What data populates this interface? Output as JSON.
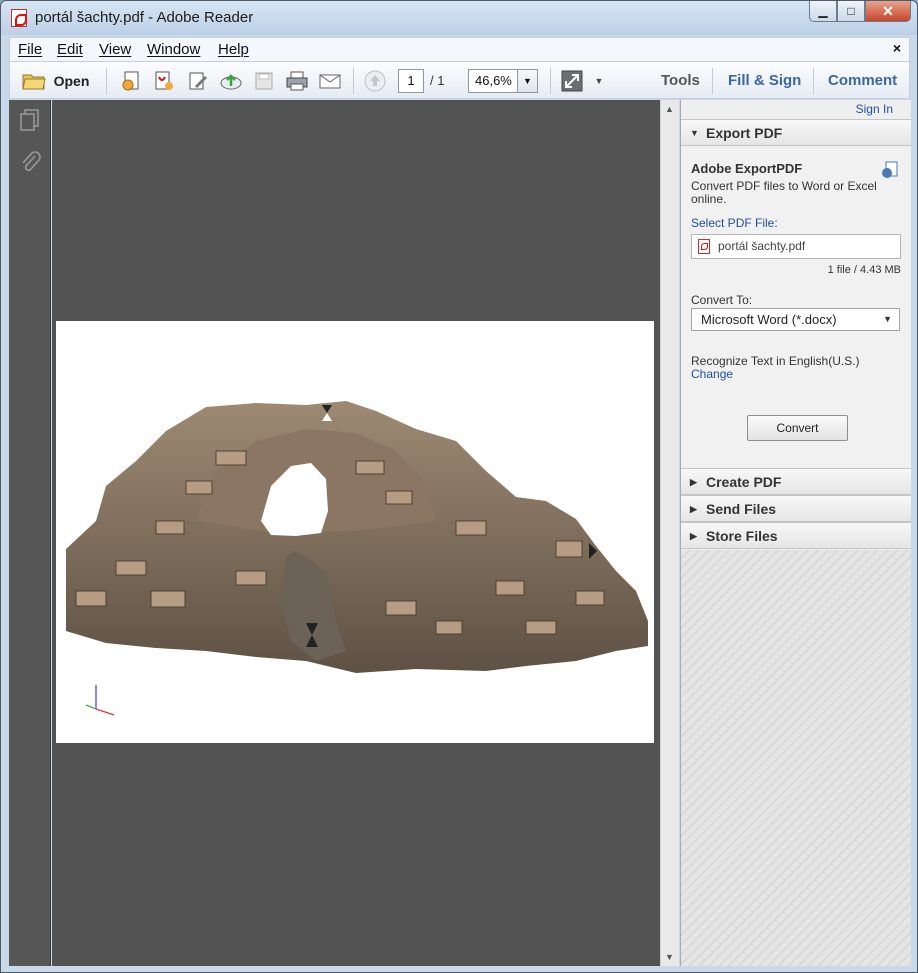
{
  "window": {
    "title": "portál šachty.pdf - Adobe Reader",
    "controls": {
      "minimize": "▁",
      "maximize": "□",
      "close": "✕"
    }
  },
  "menubar": {
    "items": [
      "File",
      "Edit",
      "View",
      "Window",
      "Help"
    ],
    "close": "×"
  },
  "toolbar": {
    "open_label": "Open",
    "page_current": "1",
    "page_total": "/ 1",
    "zoom": "46,6%",
    "tools_label": "Tools",
    "fill_sign_label": "Fill & Sign",
    "comment_label": "Comment"
  },
  "right_panel": {
    "sign_in": "Sign In",
    "export_pdf": {
      "header": "Export PDF",
      "title": "Adobe ExportPDF",
      "description_line1": "Convert PDF files to Word or Excel",
      "description_line2": "online.",
      "select_label": "Select PDF File:",
      "file_name": "portál šachty.pdf",
      "file_info": "1 file / 4.43 MB",
      "convert_to_label": "Convert To:",
      "convert_to_value": "Microsoft Word (*.docx)",
      "recognize_text": "Recognize Text in English(U.S.)",
      "change_link": "Change",
      "convert_button": "Convert"
    },
    "sections": [
      "Create PDF",
      "Send Files",
      "Store Files"
    ]
  },
  "colors": {
    "accent_link": "#3b68a3",
    "doc_background": "#535353",
    "panel_background": "#efefef"
  }
}
